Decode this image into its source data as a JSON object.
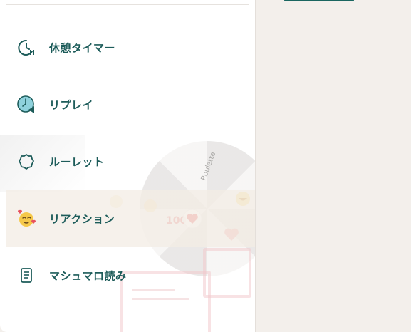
{
  "menu": {
    "items": [
      {
        "label": "休憩タイマー",
        "icon": "break-timer-icon"
      },
      {
        "label": "リプレイ",
        "icon": "replay-icon"
      },
      {
        "label": "ルーレット",
        "icon": "roulette-icon"
      },
      {
        "label": "リアクション",
        "icon": "reaction-icon"
      },
      {
        "label": "マシュマロ読み",
        "icon": "marshmallow-icon"
      }
    ],
    "active_index": 3
  },
  "decoration": {
    "roulette_text": "Roulette"
  },
  "colors": {
    "accent": "#1d5c5a",
    "panel_bg": "#ffffff",
    "page_bg": "#f3efeb",
    "active_bg": "#f3ece4"
  }
}
